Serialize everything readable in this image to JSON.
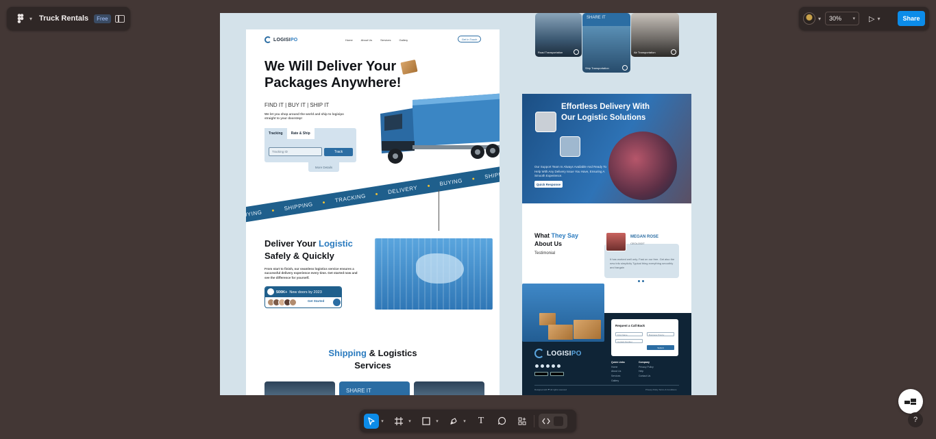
{
  "app": {
    "file_name": "Truck Rentals",
    "plan_badge": "Free",
    "zoom": "30%",
    "share_label": "Share",
    "icons": {
      "menu": "figma-logo-icon",
      "sidebar": "sidebar-toggle-icon",
      "play": "present-play-icon",
      "help": "help-icon"
    }
  },
  "toolbar": {
    "tools": [
      "move-tool",
      "frame-tool",
      "shape-tool",
      "pen-tool",
      "text-tool",
      "comment-tool",
      "actions-tool",
      "dev-mode-tool"
    ],
    "text_glyph": "T"
  },
  "design": {
    "nav": {
      "logo_a": "LOGISI",
      "logo_b": "PO",
      "links": [
        "Home",
        "About Us",
        "Services",
        "Gallery"
      ],
      "cta": "Get In Touch"
    },
    "hero": {
      "title_line1": "We Will Deliver Your",
      "title_line2": "Packages Anywhere!",
      "subtitle": "FIND IT | BUY IT | SHIP IT",
      "description": "We let you shop around the world and ship to logisipo straight to your doorstep!",
      "tab_tracking": "Tracking",
      "tab_rate": "Rate & Ship",
      "input_placeholder": "Tracking ID",
      "track_button": "Track",
      "more_details": "More Details"
    },
    "ribbon": [
      "BUYING",
      "SHIPPING",
      "TRACKING",
      "DELIVERY",
      "BUYING",
      "SHIPPING"
    ],
    "section2": {
      "title_a": "Deliver Your",
      "title_accent": "Logistic",
      "title_b": "Safely & Quickly",
      "description": "From start to finish, our seamless logistics service ensures a successful delivery experience every time. Get started now and see the difference for yourself.",
      "stat_value": "500K+",
      "stat_label": "New doors by 2023",
      "cta": "Get Started"
    },
    "section3": {
      "title_accent": "Shipping",
      "title_a": "& Logistics",
      "title_b": "Services",
      "card_mid": "SHARE IT"
    },
    "right": {
      "tiles": [
        {
          "label": "Road Transportation"
        },
        {
          "label": "Ship Transportation",
          "badge": "SHARE IT"
        },
        {
          "label": "Air Transportation"
        }
      ],
      "banner_title": "Effortless Delivery With Our Logistic Solutions",
      "banner_desc": "Our Support Team Is Always Available And Ready To Help With Any Delivery Issue You Have, Ensuring A Smooth Experience.",
      "banner_button": "Quick Response",
      "testimonial_title_a": "What",
      "testimonial_title_accent": "They Say",
      "testimonial_title_b": "About Us",
      "testimonial_sub": "Testimonial",
      "testimonial_name": "MEGAN ROSE",
      "testimonial_role": "CEOLOGIT",
      "testimonial_text": "It has worked well only. Fast on our free. Get also the new info simplicity Typical thing everything smoothly and bargain",
      "callback_title": "Request a Call Back",
      "field_first": "First Name",
      "field_business": "Business Priority",
      "field_contact": "Contact Number",
      "submit": "Submit",
      "footer_logo_a": "LOGISI",
      "footer_logo_b": "PO",
      "footer_col1_head": "Quick Links",
      "footer_col1": [
        "Home",
        "About Us",
        "Services",
        "Gallery"
      ],
      "footer_col2_head": "Company",
      "footer_col2": [
        "Privacy Policy",
        "Help",
        "Contact Us"
      ],
      "copyright": "Designed with ❤ All rights reserved",
      "legal": "Privacy Policy     Terms & Conditions"
    }
  }
}
